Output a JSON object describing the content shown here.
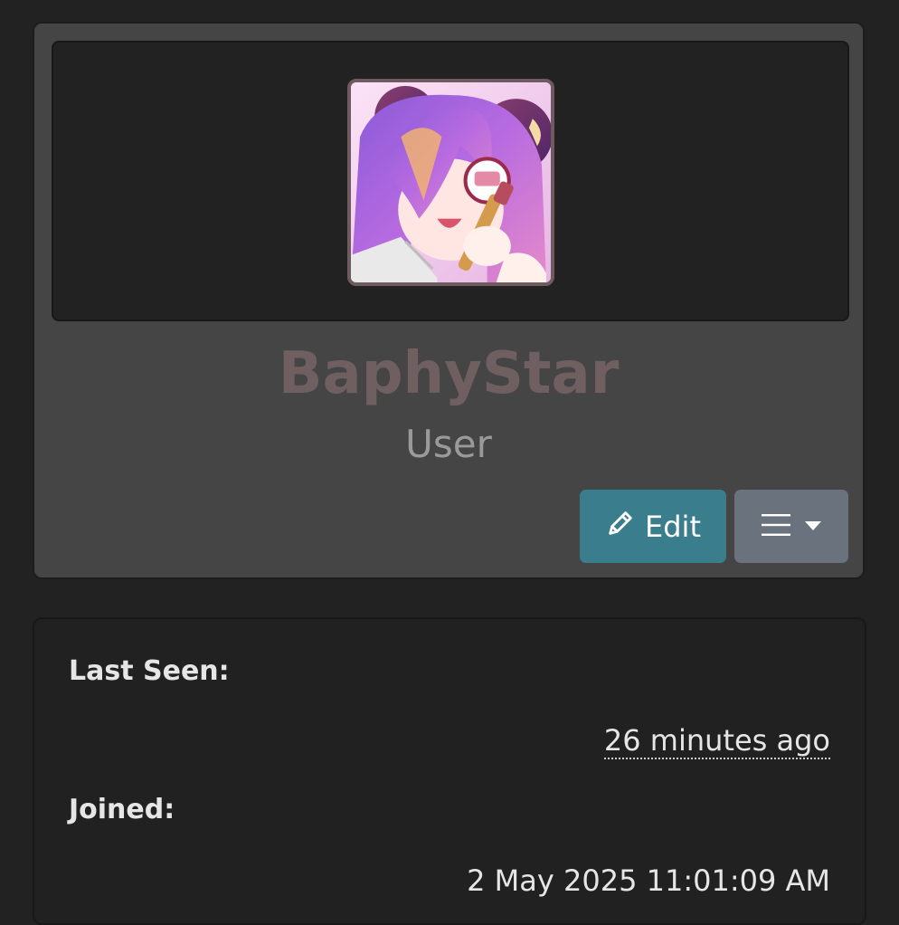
{
  "profile": {
    "username": "BaphyStar",
    "role": "User",
    "avatar_icon": "avatar-illustration",
    "colors": {
      "username": "#6f5f61",
      "edit_button": "#3a7e8e",
      "menu_button": "#6a737d"
    }
  },
  "actions": {
    "edit_label": "Edit",
    "edit_icon": "pencil-icon",
    "menu_icon": "hamburger-icon",
    "menu_caret_icon": "caret-down-icon"
  },
  "info": {
    "last_seen_label": "Last Seen:",
    "last_seen_value": "26 minutes ago",
    "joined_label": "Joined:",
    "joined_value": "2 May 2025 11:01:09 AM"
  }
}
